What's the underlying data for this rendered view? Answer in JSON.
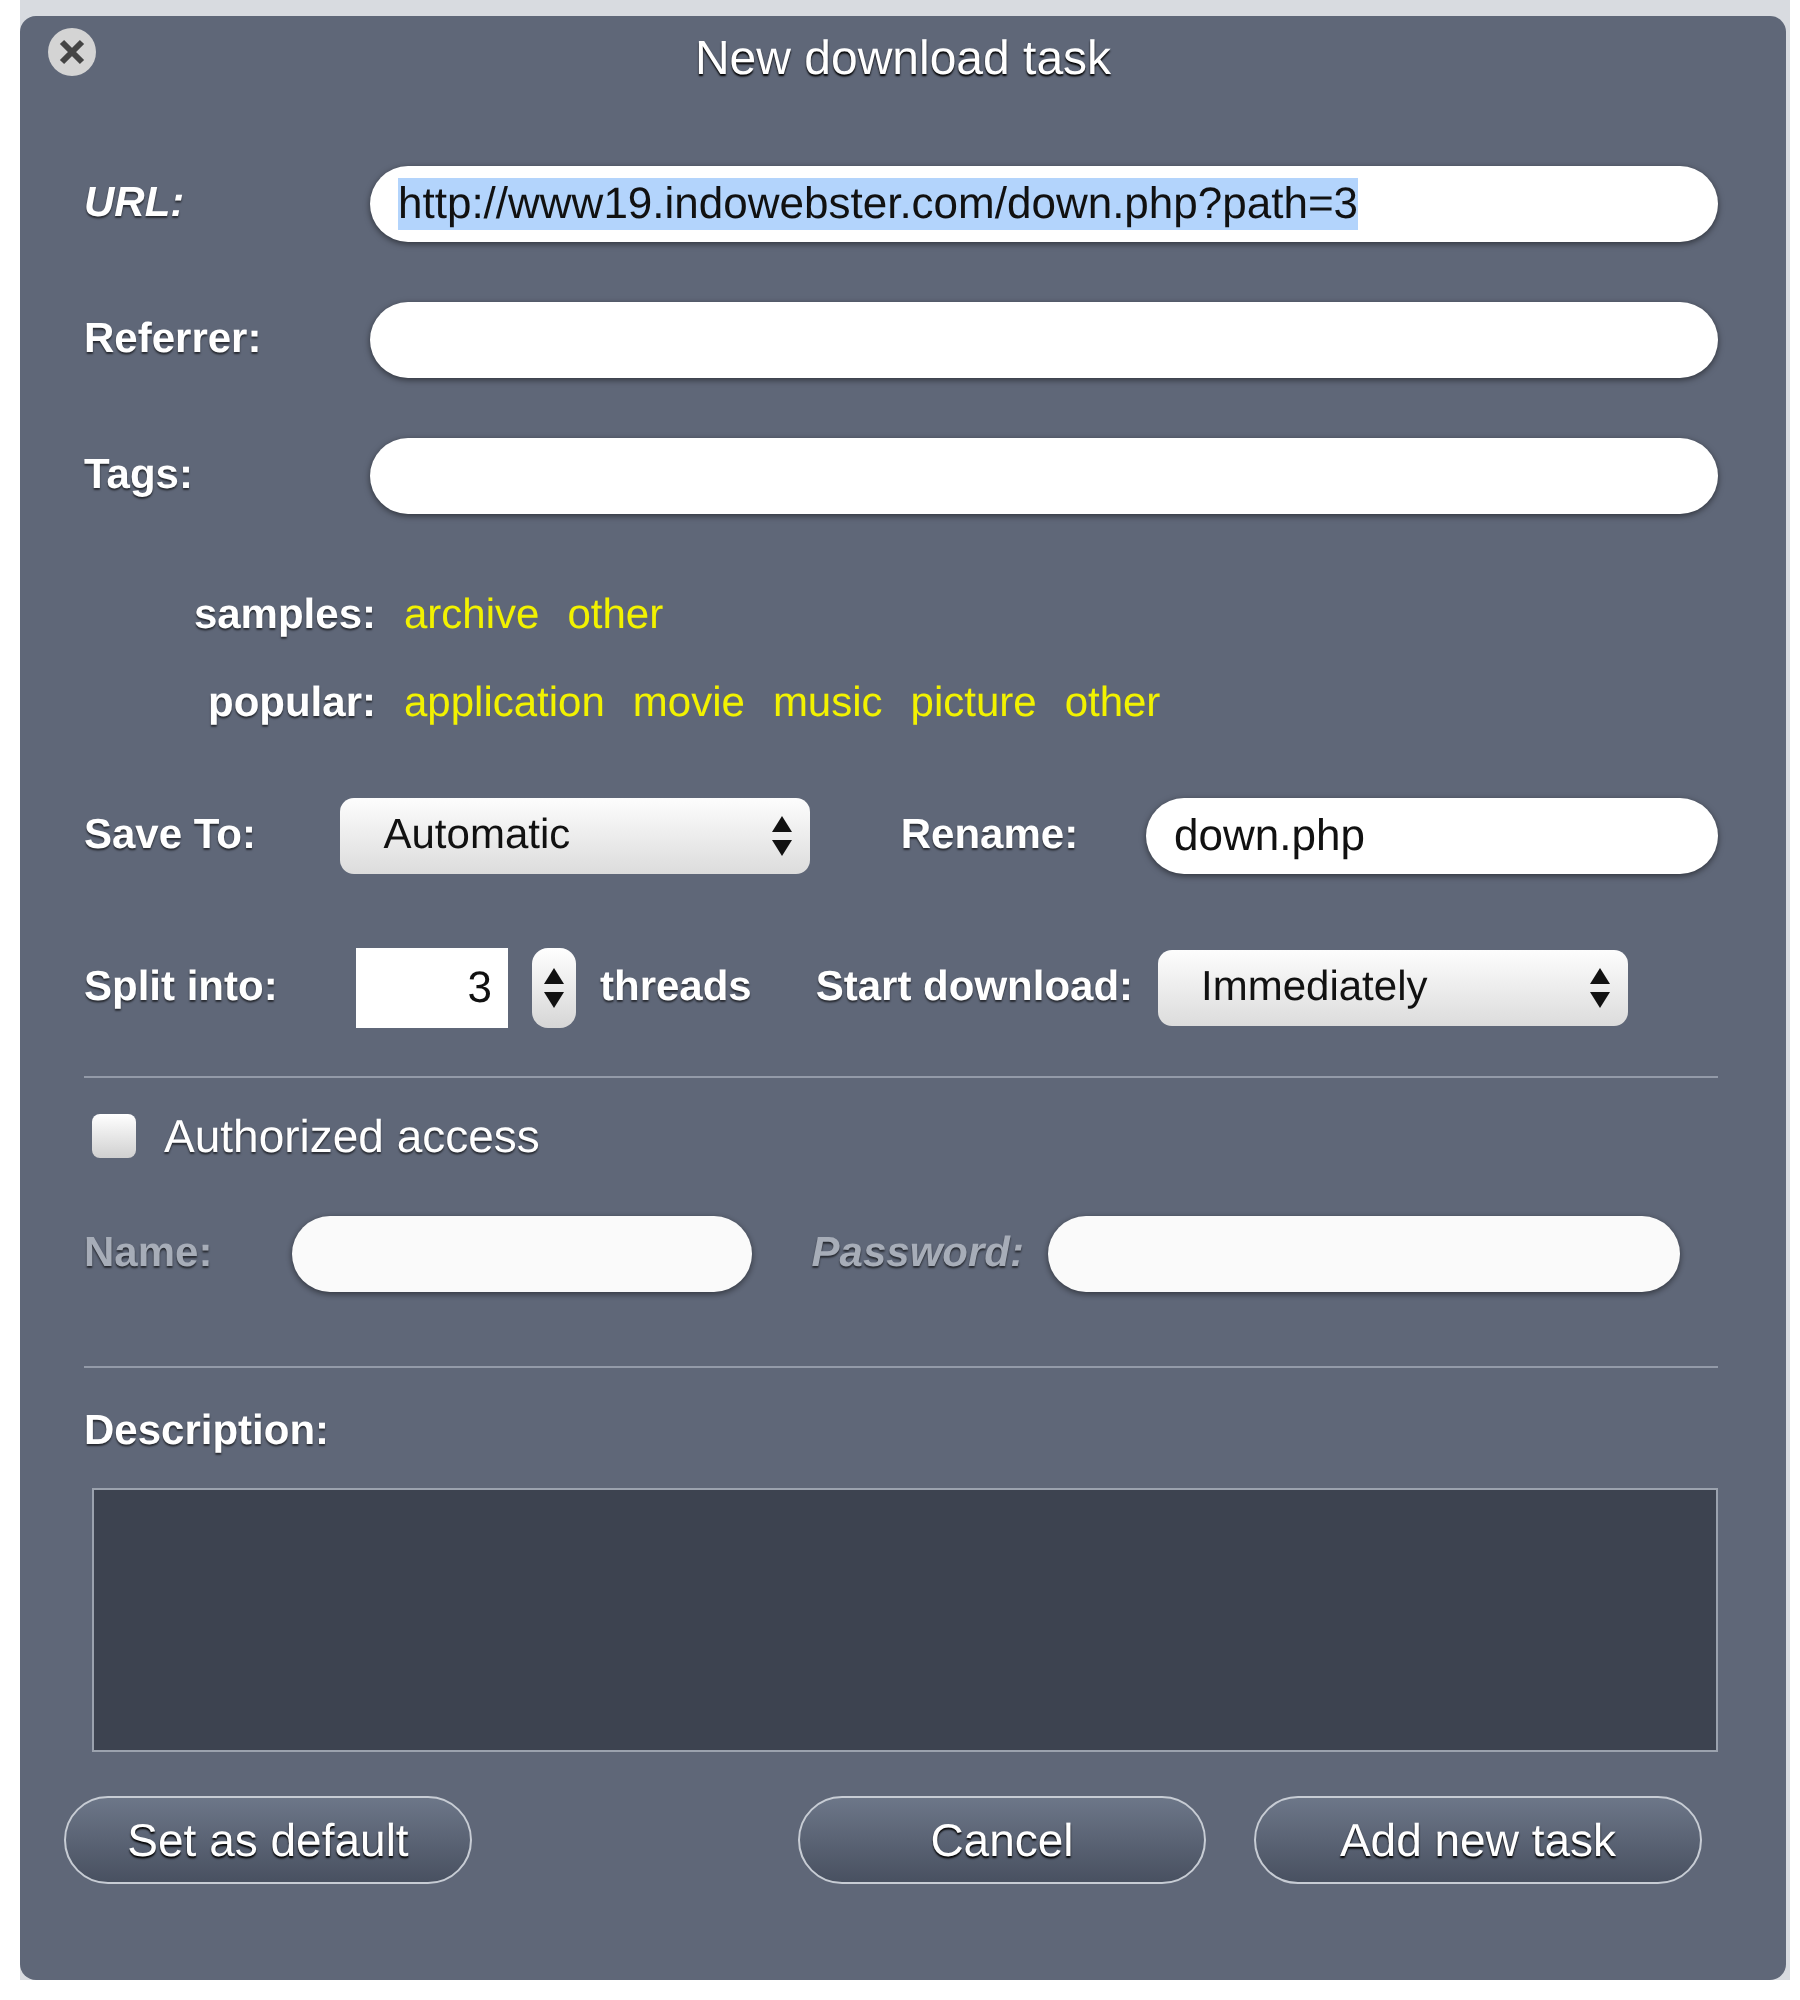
{
  "dialog": {
    "title": "New download task"
  },
  "fields": [
    {
      "label": "URL:",
      "value": "http://www19.indowebster.com/down.php?path=3",
      "selected": true
    },
    {
      "label": "Referrer:"
    },
    {
      "label": "Tags:"
    }
  ],
  "tag_groups": [
    {
      "label": "samples:",
      "tags": [
        "archive",
        "other"
      ]
    },
    {
      "label": "popular:",
      "tags": [
        "application",
        "movie",
        "music",
        "picture",
        "other"
      ]
    }
  ],
  "save_to": {
    "label": "Save To:",
    "value": "Automatic"
  },
  "rename": {
    "label": "Rename:",
    "value": "down.php"
  },
  "split": {
    "label": "Split into:",
    "value": "3",
    "unit": "threads"
  },
  "start_download": {
    "label": "Start download:",
    "value": "Immediately"
  },
  "auth": {
    "label": "Authorized access",
    "checked": false,
    "fields": [
      {
        "label": "Name:",
        "disabled": true
      },
      {
        "label": "Password:",
        "disabled": true
      }
    ]
  },
  "description": {
    "label": "Description:"
  },
  "buttons": [
    {
      "label": "Set as default"
    },
    {
      "label": "Cancel"
    },
    {
      "label": "Add new task"
    }
  ]
}
